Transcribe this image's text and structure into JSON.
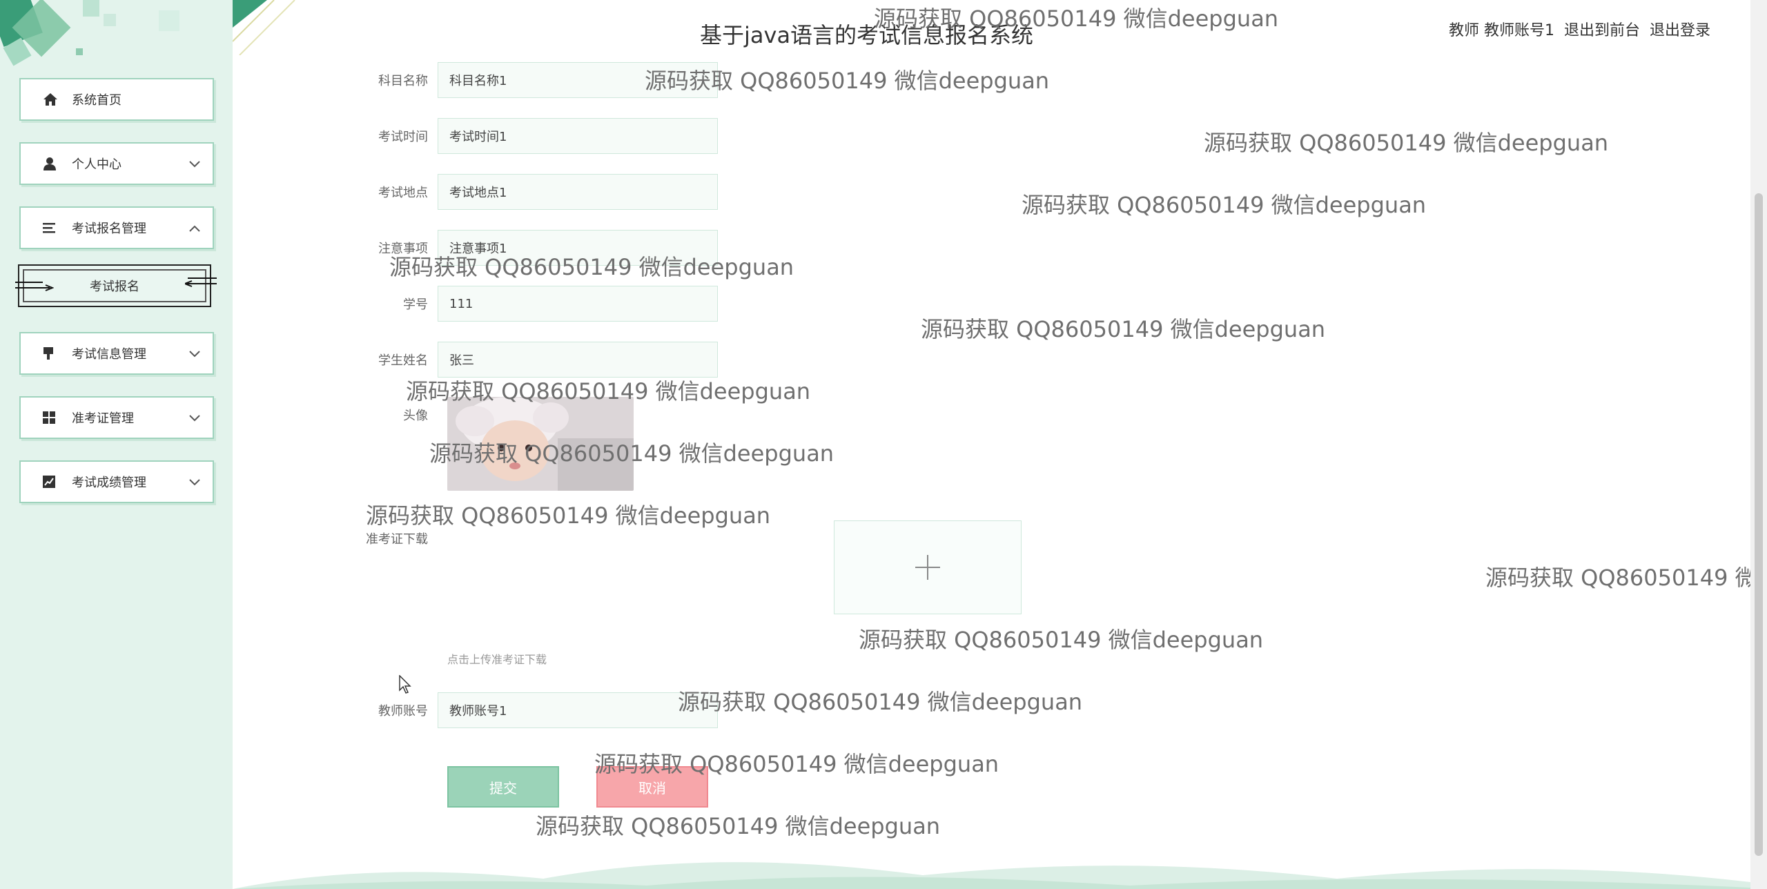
{
  "header": {
    "app_title": "基于java语言的考试信息报名系统",
    "user_label": "教师 教师账号1",
    "to_front_label": "退出到前台",
    "logout_label": "退出登录"
  },
  "sidebar": {
    "items": [
      {
        "label": "系统首页",
        "icon": "home-icon"
      },
      {
        "label": "个人中心",
        "icon": "user-icon"
      },
      {
        "label": "考试报名管理",
        "icon": "list-icon"
      },
      {
        "label": "考试信息管理",
        "icon": "flag-icon"
      },
      {
        "label": "准考证管理",
        "icon": "grid-icon"
      },
      {
        "label": "考试成绩管理",
        "icon": "chart-icon"
      }
    ],
    "sub_item": {
      "label": "考试报名"
    }
  },
  "form": {
    "fields": [
      {
        "label": "科目名称",
        "value": "科目名称1"
      },
      {
        "label": "考试时间",
        "value": "考试时间1"
      },
      {
        "label": "考试地点",
        "value": "考试地点1"
      },
      {
        "label": "注意事项",
        "value": "注意事项1"
      },
      {
        "label": "学号",
        "value": "111"
      },
      {
        "label": "学生姓名",
        "value": "张三"
      }
    ],
    "avatar_label": "头像",
    "ticket_label": "准考证下载",
    "upload_hint": "点击上传准考证下载",
    "teacher_label": "教师账号",
    "teacher_value": "教师账号1",
    "submit_label": "提交",
    "cancel_label": "取消"
  },
  "watermark_text": "源码获取 QQ86050149 微信deepguan",
  "colors": {
    "sidebar_bg": "#e3f3ec",
    "accent": "#9bd3b8",
    "cancel": "#f7a6aa"
  }
}
